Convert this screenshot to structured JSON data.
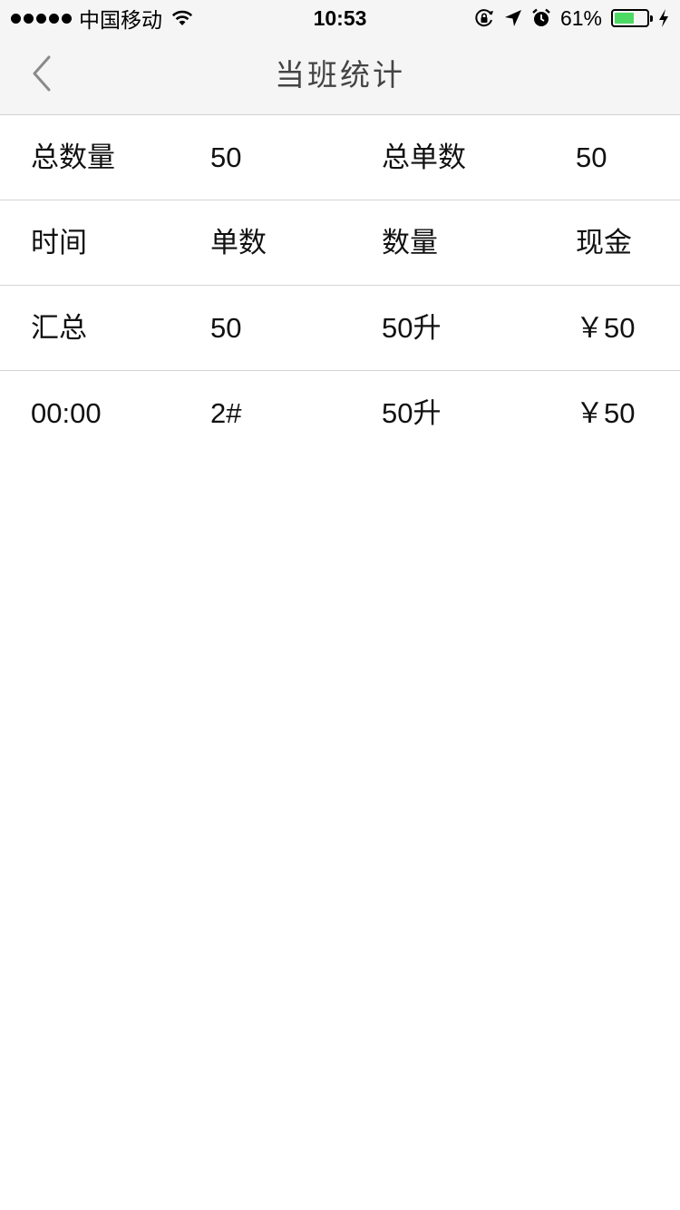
{
  "status_bar": {
    "carrier": "中国移动",
    "time": "10:53",
    "battery_percent": "61%",
    "battery_level": 0.61,
    "icons": [
      "signal-dots",
      "wifi-icon",
      "rotation-lock-icon",
      "location-arrow-icon",
      "alarm-clock-icon",
      "battery-icon",
      "charging-bolt-icon"
    ]
  },
  "nav": {
    "title": "当班统计",
    "back_icon": "chevron-left-icon"
  },
  "summary": {
    "total_qty_label": "总数量",
    "total_qty_value": "50",
    "total_orders_label": "总单数",
    "total_orders_value": "50"
  },
  "table": {
    "headers": [
      "时间",
      "单数",
      "数量",
      "现金"
    ],
    "rows": [
      [
        "汇总",
        "50",
        "50升",
        "￥50"
      ],
      [
        "00:00",
        "2#",
        "50升",
        "￥50"
      ]
    ]
  }
}
